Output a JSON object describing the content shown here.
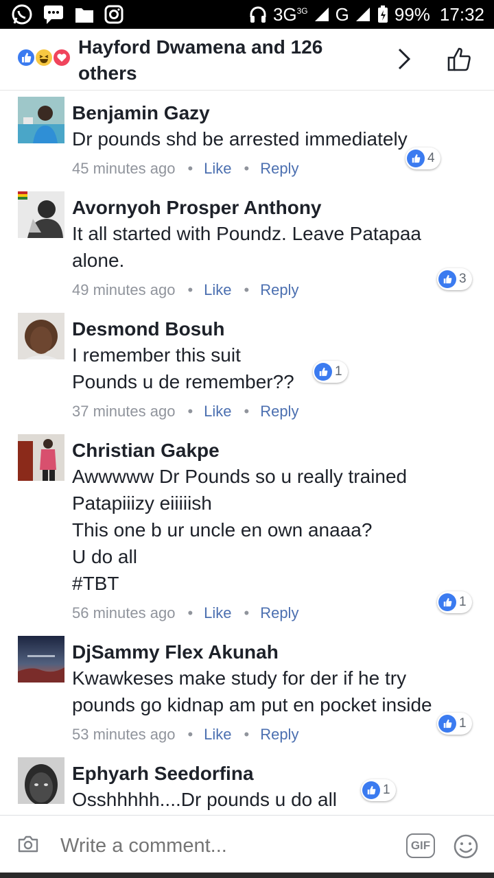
{
  "status_bar": {
    "network": "3G",
    "network_sup": "3G",
    "carrier_g": "G",
    "battery": "99%",
    "time": "17:32",
    "icons": [
      "whatsapp-icon",
      "messages-icon",
      "folder-icon",
      "instagram-icon",
      "headphones-icon",
      "signal-icon",
      "battery-icon"
    ]
  },
  "header": {
    "reactions": [
      "like",
      "haha",
      "love"
    ],
    "title": "Hayford Dwamena and 126 others",
    "colors": {
      "like": "#3b7bf0",
      "haha": "#f7c842",
      "love": "#f0445c"
    }
  },
  "comments": [
    {
      "name": "Benjamin Gazy",
      "text": "Dr pounds shd be arrested immediately",
      "time": "45 minutes ago",
      "like": "Like",
      "reply": "Reply",
      "likes": "4"
    },
    {
      "name": "Avornyoh Prosper Anthony",
      "text": "It all started with Poundz. Leave Patapaa\nalone.",
      "time": "49 minutes ago",
      "like": "Like",
      "reply": "Reply",
      "likes": "3"
    },
    {
      "name": "Desmond Bosuh",
      "text": "I remember this suit\nPounds u de remember??",
      "time": "37 minutes ago",
      "like": "Like",
      "reply": "Reply",
      "likes": "1"
    },
    {
      "name": "Christian Gakpe",
      "text": "Awwwww Dr Pounds so u really trained\nPatapiiizy eiiiiish\nThis one b ur uncle en own anaaa?\nU do all\n#TBT",
      "time": "56 minutes ago",
      "like": "Like",
      "reply": "Reply",
      "likes": "1"
    },
    {
      "name": "DjSammy Flex Akunah",
      "text": "Kwawkeses make study for der if he try\npounds go kidnap am put en pocket inside",
      "time": "53 minutes ago",
      "like": "Like",
      "reply": "Reply",
      "likes": "1"
    },
    {
      "name": "Ephyarh Seedorfina",
      "text": "Osshhhhh....Dr pounds u do all",
      "time": "",
      "like": "",
      "reply": "",
      "likes": "1"
    }
  ],
  "composer": {
    "placeholder": "Write a comment...",
    "gif_label": "GIF"
  },
  "accent_color": "#4b6fb0"
}
